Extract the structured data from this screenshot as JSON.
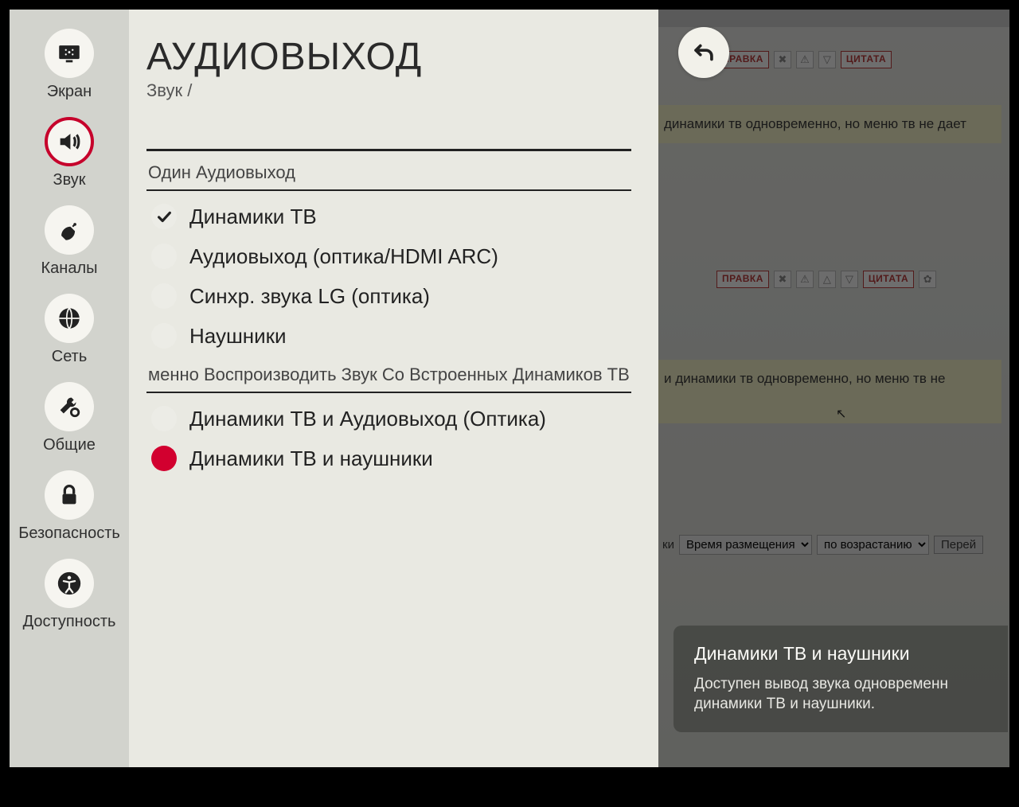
{
  "sidebar": {
    "items": [
      {
        "label": "Экран"
      },
      {
        "label": "Звук"
      },
      {
        "label": "Каналы"
      },
      {
        "label": "Сеть"
      },
      {
        "label": "Общие"
      },
      {
        "label": "Безопасность"
      },
      {
        "label": "Доступность"
      }
    ]
  },
  "panel": {
    "title": "АУДИОВЫХОД",
    "breadcrumb": "Звук /",
    "group1_label": "Один Аудиовыход",
    "group1": [
      {
        "label": "Динамики ТВ"
      },
      {
        "label": "Аудиовыход (оптика/HDMI ARC)"
      },
      {
        "label": "Синхр. звука LG (оптика)"
      },
      {
        "label": "Наушники"
      }
    ],
    "group2_label": "менно Воспроизводить Звук Со Встроенных Динамиков ТВ",
    "group2": [
      {
        "label": "Динамики ТВ и Аудиовыход (Оптика)"
      },
      {
        "label": "Динамики ТВ и наушники"
      }
    ]
  },
  "tooltip": {
    "title": "Динамики ТВ и наушники",
    "body": "Доступен вывод звука одновременн динамики ТВ и наушники."
  },
  "bg": {
    "post1_text": "динамики тв одновременно, но меню тв не дает",
    "post2_text": "и динамики тв одновременно, но меню тв не",
    "btn_edit": "ПРАВКА",
    "btn_quote": "ЦИТАТА",
    "sort_label_1": "ки",
    "sort_opt_1": "Время размещения",
    "sort_opt_2": "по возрастанию",
    "sort_go": "Перей"
  }
}
